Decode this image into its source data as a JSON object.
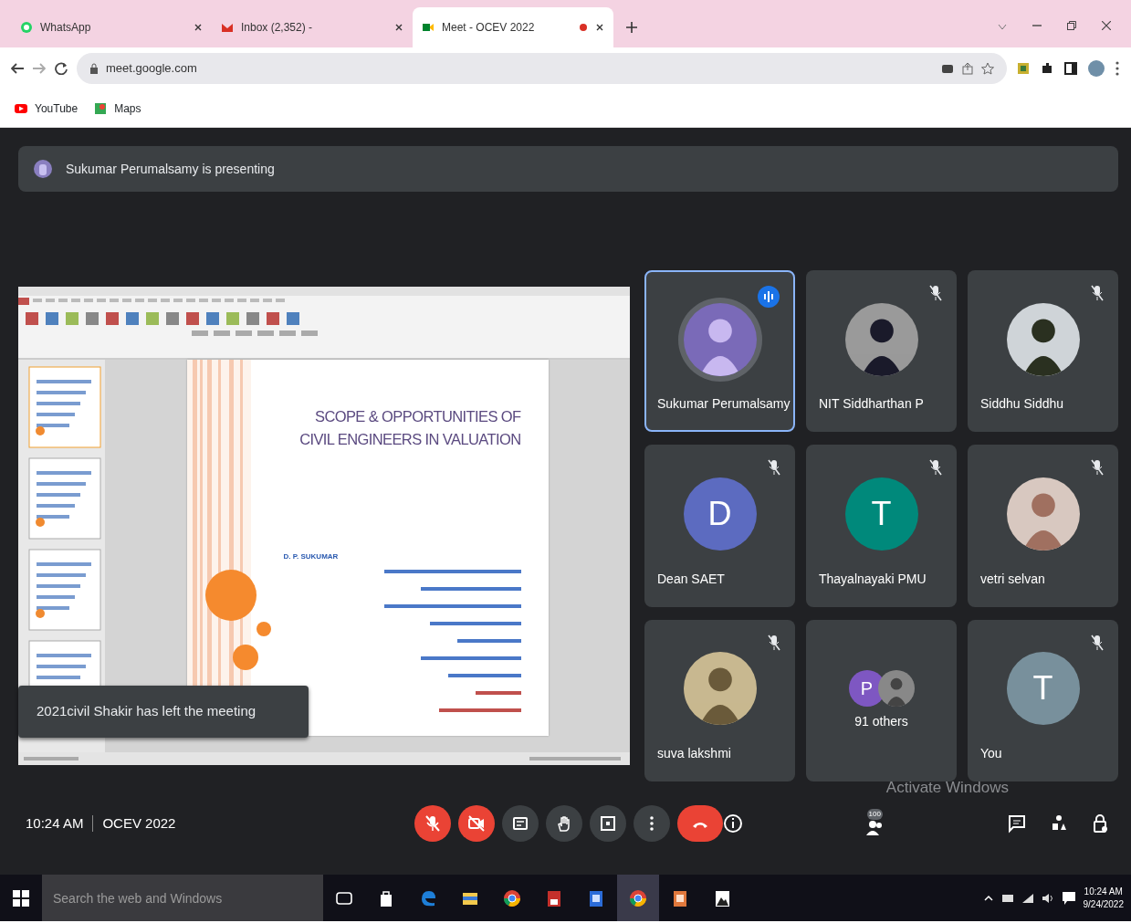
{
  "browser": {
    "tabs": [
      {
        "title": "WhatsApp",
        "kind": "whatsapp",
        "selected": false,
        "recording": false
      },
      {
        "title": "Inbox (2,352) - ",
        "kind": "gmail",
        "selected": false,
        "recording": false
      },
      {
        "title": "Meet - OCEV 2022",
        "kind": "meet",
        "selected": true,
        "recording": true
      }
    ],
    "address": "meet.google.com",
    "bookmarks": [
      {
        "label": "YouTube",
        "kind": "youtube"
      },
      {
        "label": "Maps",
        "kind": "maps"
      }
    ]
  },
  "meet": {
    "presenting_banner": "Sukumar Perumalsamy is presenting",
    "slide": {
      "title_lines": [
        "SCOPE & OPPORTUNITIES OF",
        "CIVIL ENGINEERS IN VALUATION"
      ],
      "author": "D. P. SUKUMAR"
    },
    "toast": "2021civil Shakir has left the meeting",
    "participants": [
      {
        "name": "Sukumar Perumalsamy",
        "muted": false,
        "speaking": true
      },
      {
        "name": "NIT Siddharthan P",
        "muted": true,
        "speaking": false
      },
      {
        "name": "Siddhu Siddhu",
        "muted": true,
        "speaking": false
      },
      {
        "name": "Dean SAET",
        "kind": "initial",
        "initial": "D",
        "color": "#5c6bc0",
        "muted": true,
        "speaking": false
      },
      {
        "name": "Thayalnayaki PMU",
        "kind": "initial",
        "initial": "T",
        "color": "#00897b",
        "muted": true,
        "speaking": false
      },
      {
        "name": "vetri selvan",
        "muted": true,
        "speaking": false
      },
      {
        "name": "suva lakshmi",
        "muted": true,
        "speaking": false
      },
      {
        "name": "91 others",
        "kind": "others",
        "initial": "P",
        "color": "#7e57c2",
        "muted": false,
        "speaking": false
      },
      {
        "name": "You",
        "kind": "initial",
        "initial": "T",
        "color": "#78909c",
        "muted": true,
        "speaking": false
      }
    ],
    "time": "10:24 AM",
    "meeting_name": "OCEV 2022",
    "controls": [
      {
        "kind": "mic",
        "on": false
      },
      {
        "kind": "camera",
        "on": false
      },
      {
        "kind": "captions"
      },
      {
        "kind": "hand"
      },
      {
        "kind": "present"
      },
      {
        "kind": "more"
      },
      {
        "kind": "leave"
      }
    ],
    "side_buttons": [
      {
        "kind": "info"
      },
      {
        "kind": "people",
        "badge": "100"
      },
      {
        "kind": "chat"
      },
      {
        "kind": "activities"
      },
      {
        "kind": "lock"
      }
    ],
    "system_notice": "Activate Windows"
  },
  "taskbar": {
    "search_placeholder": "Search the web and Windows",
    "apps": [
      {
        "kind": "taskview",
        "active": false
      },
      {
        "kind": "store",
        "active": false
      },
      {
        "kind": "edge",
        "active": false
      },
      {
        "kind": "folder",
        "active": false
      },
      {
        "kind": "chrome",
        "active": false
      },
      {
        "kind": "reader",
        "active": false
      },
      {
        "kind": "word",
        "active": false
      },
      {
        "kind": "chrome",
        "active": true
      },
      {
        "kind": "powerpoint",
        "active": false
      },
      {
        "kind": "photos",
        "active": false
      }
    ],
    "time": "10:24 AM",
    "date": "9/24/2022"
  }
}
